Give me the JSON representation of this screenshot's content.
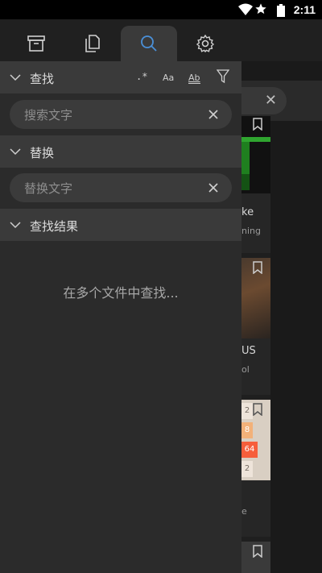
{
  "status_bar": {
    "time": "2:11"
  },
  "tabs": [
    {
      "name": "archive",
      "active": false
    },
    {
      "name": "files",
      "active": false
    },
    {
      "name": "search",
      "active": true
    },
    {
      "name": "settings",
      "active": false
    }
  ],
  "find": {
    "header": "查找",
    "placeholder": "搜索文字",
    "options": {
      "regex": ".*",
      "case": "Aa",
      "word": "Ab"
    }
  },
  "replace": {
    "header": "替换",
    "placeholder": "替换文字"
  },
  "results": {
    "header": "查找结果",
    "empty_message": "在多个文件中查找..."
  },
  "background": {
    "cards": [
      {
        "title": "ke",
        "subtitle": "ning"
      },
      {
        "title": "US",
        "subtitle": "ol"
      },
      {
        "title": "",
        "subtitle": "e"
      }
    ],
    "tile_values": [
      "2",
      "8",
      "64",
      "2"
    ]
  },
  "colors": {
    "accent": "#4a90d9",
    "drawer_bg": "#2b2b2b",
    "header_bg": "#3a3a3a"
  }
}
